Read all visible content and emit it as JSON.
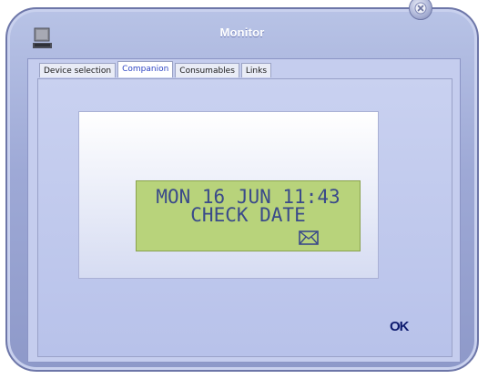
{
  "window": {
    "title": "Monitor"
  },
  "tabs": [
    {
      "label": "Device selection"
    },
    {
      "label": "Companion"
    },
    {
      "label": "Consumables"
    },
    {
      "label": "Links"
    }
  ],
  "lcd": {
    "line1": "MON 16 JUN 11:43",
    "line2": "CHECK DATE",
    "icon": "envelope-icon"
  },
  "buttons": {
    "ok_label": "OK",
    "close_icon": "close-icon"
  },
  "colors": {
    "active_tab_text": "#2f46c4",
    "lcd_background": "#b8d37b",
    "lcd_text": "#3a4a8a"
  }
}
